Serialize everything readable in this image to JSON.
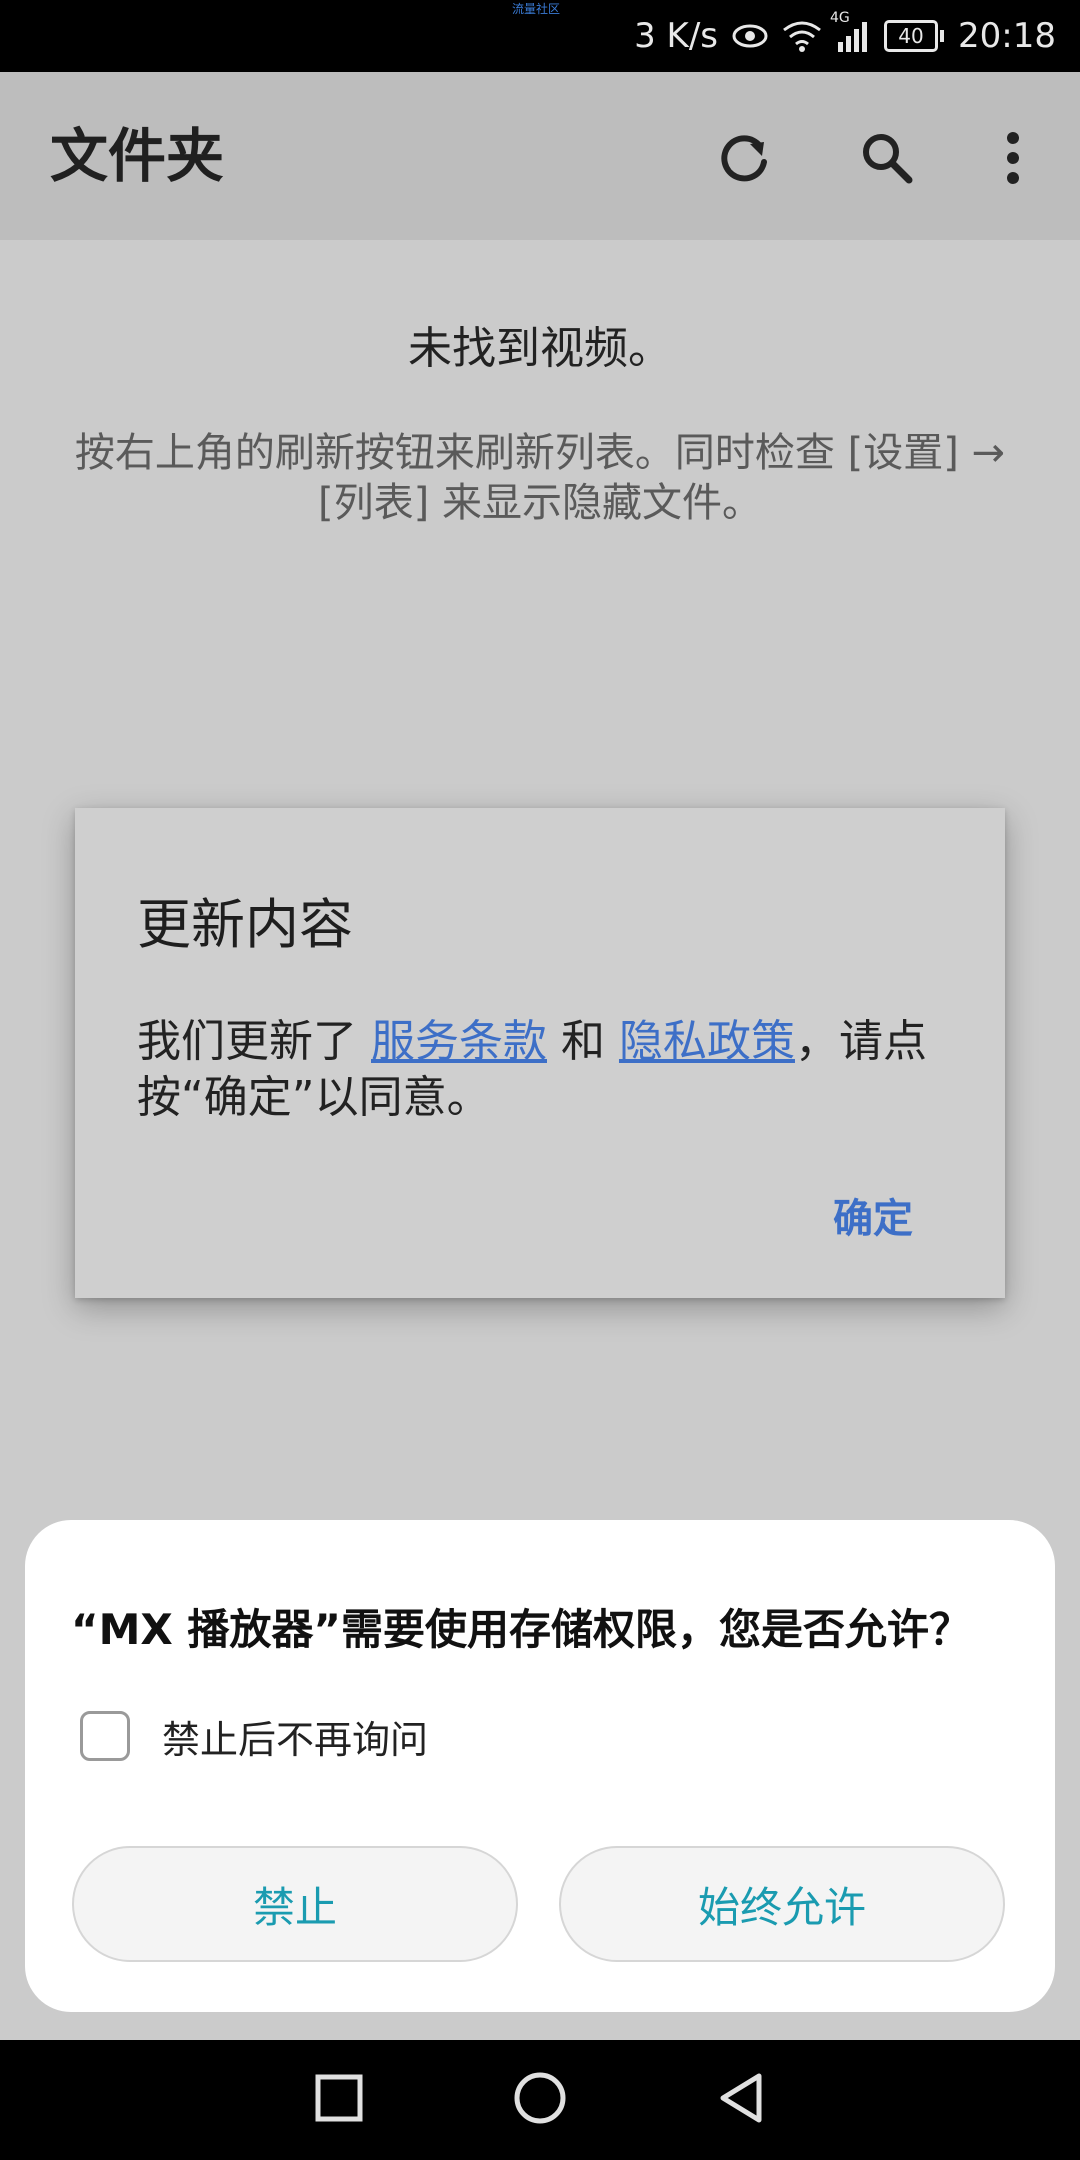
{
  "status_bar": {
    "carrier_tiny": "流量社区",
    "net_speed": "3 K/s",
    "network_type": "4G",
    "battery": "40",
    "time": "20:18",
    "icons": [
      "eye-icon",
      "wifi-icon",
      "signal-icon",
      "battery-icon"
    ]
  },
  "app_bar": {
    "title": "文件夹",
    "actions": [
      "refresh-icon",
      "search-icon",
      "more-vert-icon"
    ]
  },
  "empty_state": {
    "title": "未找到视频。",
    "hint": "按右上角的刷新按钮来刷新列表。同时检查 [设置] → [列表] 来显示隐藏文件。"
  },
  "update_dialog": {
    "title": "更新内容",
    "body_prefix": "我们更新了 ",
    "terms_link": "服务条款",
    "body_mid": " 和 ",
    "privacy_link": "隐私政策",
    "body_suffix": "，请点按“确定”以同意。",
    "ok_label": "确定",
    "link_color": "#3d6fc7"
  },
  "permission_dialog": {
    "question": "“MX 播放器”需要使用存储权限，您是否允许？",
    "checkbox_label": "禁止后不再询问",
    "checkbox_checked": false,
    "deny_label": "禁止",
    "allow_label": "始终允许",
    "button_text_color": "#1a9bb0"
  },
  "nav_bar": {
    "icons": [
      "recents-square-icon",
      "home-circle-icon",
      "back-triangle-icon"
    ]
  }
}
